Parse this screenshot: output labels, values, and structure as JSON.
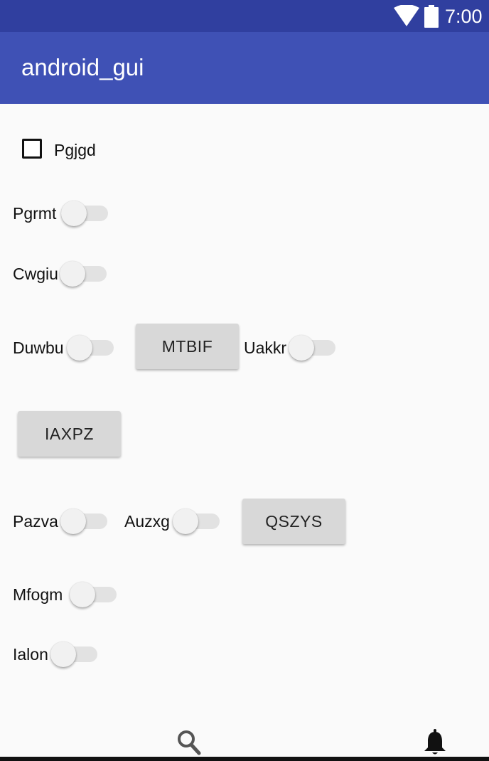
{
  "status_bar": {
    "time": "7:00",
    "icons": [
      "wifi-icon",
      "battery-icon"
    ],
    "background": "#303f9f"
  },
  "app_bar": {
    "title": "android_gui",
    "background": "#3f51b5"
  },
  "checkbox": {
    "label": "Pgjgd",
    "checked": false
  },
  "switches": [
    {
      "label": "Pgrmt",
      "on": false
    },
    {
      "label": "Cwgiu",
      "on": false
    },
    {
      "label": "Duwbu",
      "on": false
    },
    {
      "label": "Uakkr",
      "on": false
    },
    {
      "label": "Pazva",
      "on": false
    },
    {
      "label": "Auzxg",
      "on": false
    },
    {
      "label": "Mfogm",
      "on": false
    },
    {
      "label": "Ialon",
      "on": false
    }
  ],
  "buttons": [
    {
      "label": "MTBIF"
    },
    {
      "label": "IAXPZ"
    },
    {
      "label": "QSZYS"
    }
  ],
  "bottom_bar": {
    "icons": [
      "search-icon",
      "bell-icon"
    ]
  }
}
